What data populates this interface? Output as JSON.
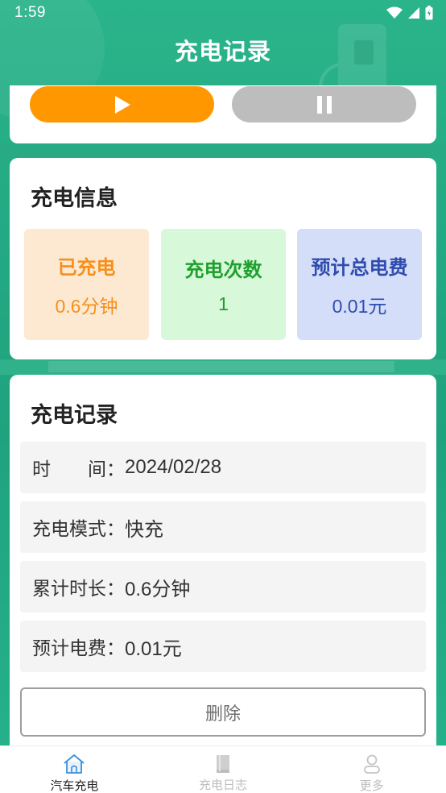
{
  "status_bar": {
    "time": "1:59"
  },
  "header": {
    "title": "充电记录"
  },
  "colors": {
    "accent_green": "#23a983",
    "play_orange": "#ff9800",
    "pause_gray": "#bdbdbd"
  },
  "controls": {
    "play_icon": "play-icon",
    "pause_icon": "pause-icon"
  },
  "charge_info": {
    "title": "充电信息",
    "stats": [
      {
        "label": "已充电",
        "value": "0.6分钟"
      },
      {
        "label": "充电次数",
        "value": "1"
      },
      {
        "label": "预计总电费",
        "value": "0.01元"
      }
    ]
  },
  "records": {
    "title": "充电记录",
    "rows": [
      {
        "label": "时　　间：",
        "value": "2024/02/28"
      },
      {
        "label": "充电模式：",
        "value": "快充"
      },
      {
        "label": "累计时长：",
        "value": "0.6分钟"
      },
      {
        "label": "预计电费：",
        "value": "0.01元"
      }
    ],
    "delete_label": "删除"
  },
  "nav": {
    "items": [
      {
        "label": "汽车充电",
        "icon": "home-icon",
        "active": true
      },
      {
        "label": "充电日志",
        "icon": "book-icon",
        "active": false
      },
      {
        "label": "更多",
        "icon": "user-icon",
        "active": false
      }
    ]
  }
}
